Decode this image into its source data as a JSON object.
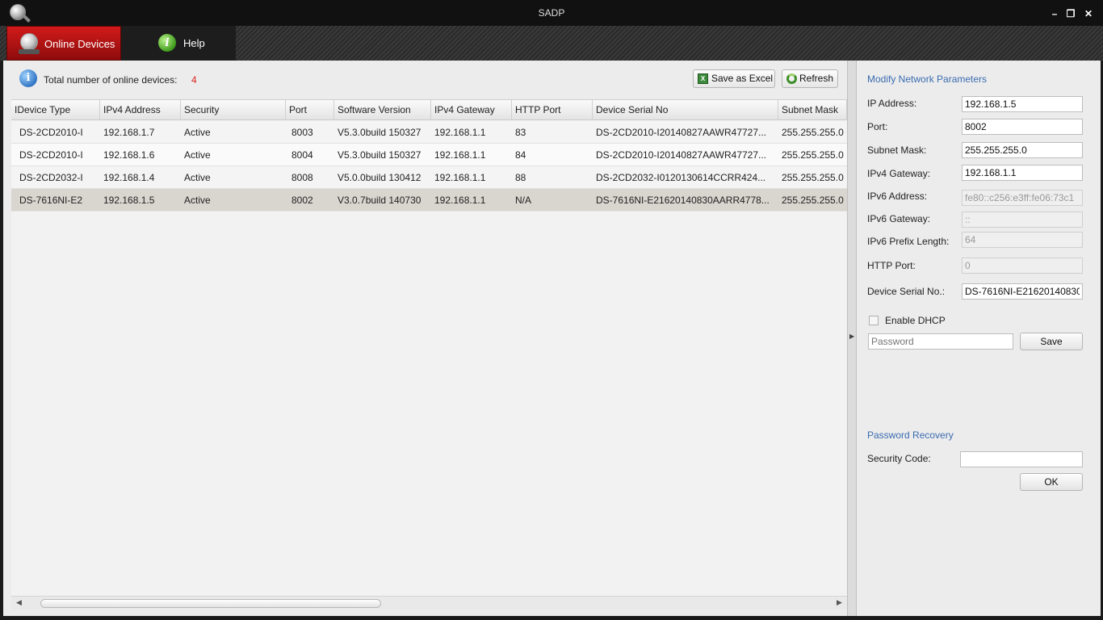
{
  "window": {
    "title": "SADP"
  },
  "tabs": [
    {
      "label": "Online Devices"
    },
    {
      "label": "Help"
    }
  ],
  "summary": {
    "label": "Total number of online devices:",
    "count": "4"
  },
  "toolbar": {
    "save_excel": "Save as Excel",
    "refresh": "Refresh"
  },
  "table": {
    "columns": [
      "IDevice Type",
      "IPv4 Address",
      "Security",
      "Port",
      "Software Version",
      "IPv4 Gateway",
      "HTTP Port",
      "Device Serial No",
      "Subnet Mask"
    ],
    "rows": [
      [
        "DS-2CD2010-I",
        "192.168.1.7",
        "Active",
        "8003",
        "V5.3.0build 150327",
        "192.168.1.1",
        "83",
        "DS-2CD2010-I20140827AAWR47727...",
        "255.255.255.0"
      ],
      [
        "DS-2CD2010-I",
        "192.168.1.6",
        "Active",
        "8004",
        "V5.3.0build 150327",
        "192.168.1.1",
        "84",
        "DS-2CD2010-I20140827AAWR47727...",
        "255.255.255.0"
      ],
      [
        "DS-2CD2032-I",
        "192.168.1.4",
        "Active",
        "8008",
        "V5.0.0build 130412",
        "192.168.1.1",
        "88",
        "DS-2CD2032-I0120130614CCRR424...",
        "255.255.255.0"
      ],
      [
        "DS-7616NI-E2",
        "192.168.1.5",
        "Active",
        "8002",
        "V3.0.7build 140730",
        "192.168.1.1",
        "N/A",
        "DS-7616NI-E21620140830AARR4778...",
        "255.255.255.0"
      ]
    ]
  },
  "modify": {
    "title": "Modify Network Parameters",
    "fields": [
      {
        "label": "IP Address:",
        "value": "192.168.1.5",
        "disabled": false
      },
      {
        "label": "Port:",
        "value": "8002",
        "disabled": false
      },
      {
        "label": "Subnet Mask:",
        "value": "255.255.255.0",
        "disabled": false
      },
      {
        "label": "IPv4 Gateway:",
        "value": "192.168.1.1",
        "disabled": false
      },
      {
        "label": "IPv6 Address:",
        "value": "fe80::c256:e3ff:fe06:73c1",
        "disabled": true
      },
      {
        "label": "IPv6 Gateway:",
        "value": "::",
        "disabled": true
      },
      {
        "label": "IPv6 Prefix Length:",
        "value": "64",
        "disabled": true
      },
      {
        "label": "HTTP Port:",
        "value": "0",
        "disabled": true
      },
      {
        "label": "Device Serial No.:",
        "value": "DS-7616NI-E21620140830",
        "disabled": false
      }
    ],
    "dhcp_label": "Enable DHCP",
    "password_placeholder": "Password",
    "save_label": "Save"
  },
  "recovery": {
    "title": "Password Recovery",
    "security_label": "Security Code:",
    "security_value": "",
    "ok_label": "OK"
  }
}
